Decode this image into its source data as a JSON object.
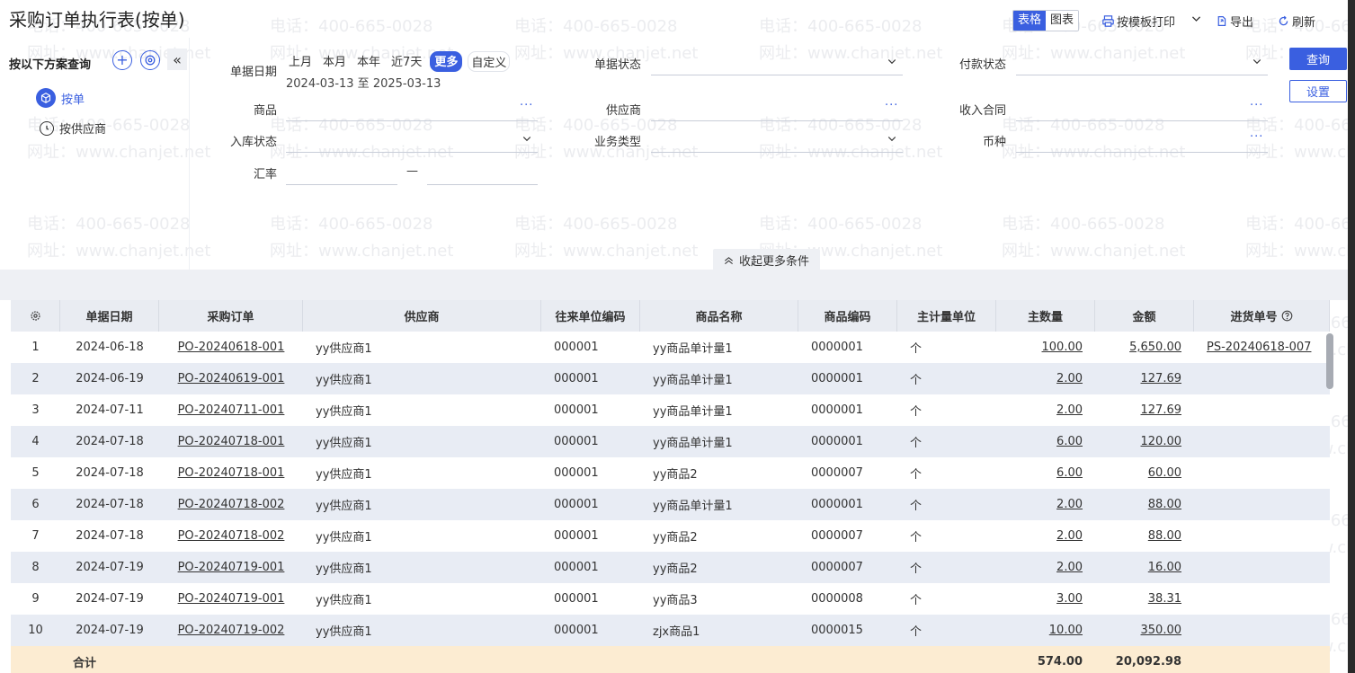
{
  "header": {
    "title": "采购订单执行表(按单)",
    "view_table": "表格",
    "view_chart": "图表",
    "print": "按模板打印",
    "export": "导出",
    "refresh": "刷新"
  },
  "scheme": {
    "title": "按以下方案查询",
    "items": [
      {
        "label": "按单",
        "active": true
      },
      {
        "label": "按供应商",
        "active": false
      }
    ]
  },
  "filters": {
    "date_label": "单据日期",
    "period_options": [
      "上月",
      "本月",
      "本年",
      "近7天",
      "更多",
      "自定义"
    ],
    "date_range": "2024-03-13 至 2025-03-13",
    "doc_status_label": "单据状态",
    "pay_status_label": "付款状态",
    "goods_label": "商品",
    "supplier_label": "供应商",
    "contract_label": "收入合同",
    "stock_status_label": "入库状态",
    "biz_type_label": "业务类型",
    "currency_label": "币种",
    "rate_label": "汇率",
    "rate_dash": "—",
    "more_dots": "···",
    "query_button": "查询",
    "settings_button": "设置",
    "collapse_more": "收起更多条件"
  },
  "table": {
    "columns": [
      "单据日期",
      "采购订单",
      "供应商",
      "往来单位编码",
      "商品名称",
      "商品编码",
      "主计量单位",
      "主数量",
      "金额",
      "进货单号"
    ],
    "rows": [
      {
        "no": "1",
        "date": "2024-06-18",
        "order": "PO-20240618-001",
        "supplier": "yy供应商1",
        "partner_code": "000001",
        "goods": "yy商品单计量1",
        "goods_code": "0000001",
        "unit": "个",
        "qty": "100.00",
        "amount": "5,650.00",
        "receipt": "PS-20240618-007"
      },
      {
        "no": "2",
        "date": "2024-06-19",
        "order": "PO-20240619-001",
        "supplier": "yy供应商1",
        "partner_code": "000001",
        "goods": "yy商品单计量1",
        "goods_code": "0000001",
        "unit": "个",
        "qty": "2.00",
        "amount": "127.69",
        "receipt": ""
      },
      {
        "no": "3",
        "date": "2024-07-11",
        "order": "PO-20240711-001",
        "supplier": "yy供应商1",
        "partner_code": "000001",
        "goods": "yy商品单计量1",
        "goods_code": "0000001",
        "unit": "个",
        "qty": "2.00",
        "amount": "127.69",
        "receipt": ""
      },
      {
        "no": "4",
        "date": "2024-07-18",
        "order": "PO-20240718-001",
        "supplier": "yy供应商1",
        "partner_code": "000001",
        "goods": "yy商品单计量1",
        "goods_code": "0000001",
        "unit": "个",
        "qty": "6.00",
        "amount": "120.00",
        "receipt": ""
      },
      {
        "no": "5",
        "date": "2024-07-18",
        "order": "PO-20240718-001",
        "supplier": "yy供应商1",
        "partner_code": "000001",
        "goods": "yy商品2",
        "goods_code": "0000007",
        "unit": "个",
        "qty": "6.00",
        "amount": "60.00",
        "receipt": ""
      },
      {
        "no": "6",
        "date": "2024-07-18",
        "order": "PO-20240718-002",
        "supplier": "yy供应商1",
        "partner_code": "000001",
        "goods": "yy商品单计量1",
        "goods_code": "0000001",
        "unit": "个",
        "qty": "2.00",
        "amount": "88.00",
        "receipt": ""
      },
      {
        "no": "7",
        "date": "2024-07-18",
        "order": "PO-20240718-002",
        "supplier": "yy供应商1",
        "partner_code": "000001",
        "goods": "yy商品2",
        "goods_code": "0000007",
        "unit": "个",
        "qty": "2.00",
        "amount": "88.00",
        "receipt": ""
      },
      {
        "no": "8",
        "date": "2024-07-19",
        "order": "PO-20240719-001",
        "supplier": "yy供应商1",
        "partner_code": "000001",
        "goods": "yy商品2",
        "goods_code": "0000007",
        "unit": "个",
        "qty": "2.00",
        "amount": "16.00",
        "receipt": ""
      },
      {
        "no": "9",
        "date": "2024-07-19",
        "order": "PO-20240719-001",
        "supplier": "yy供应商1",
        "partner_code": "000001",
        "goods": "yy商品3",
        "goods_code": "0000008",
        "unit": "个",
        "qty": "3.00",
        "amount": "38.31",
        "receipt": ""
      },
      {
        "no": "10",
        "date": "2024-07-19",
        "order": "PO-20240719-002",
        "supplier": "yy供应商1",
        "partner_code": "000001",
        "goods": "zjx商品1",
        "goods_code": "0000015",
        "unit": "个",
        "qty": "10.00",
        "amount": "350.00",
        "receipt": ""
      }
    ],
    "total": {
      "label": "合计",
      "qty": "574.00",
      "amount": "20,092.98"
    }
  },
  "watermark": {
    "phone": "电话：400-665-0028",
    "site": "网址：www.chanjet.net"
  },
  "colors": {
    "accent": "#3a5fe0",
    "row_alt": "#e8ecf4",
    "total_bg": "#fcecd2"
  },
  "icons": [
    "plus-icon",
    "settings-icon",
    "double-chevron-left-icon",
    "cube-icon",
    "clock-icon",
    "chevron-down-icon",
    "print-icon",
    "export-icon",
    "refresh-icon",
    "gear-icon",
    "help-icon",
    "chevron-up-icon"
  ]
}
